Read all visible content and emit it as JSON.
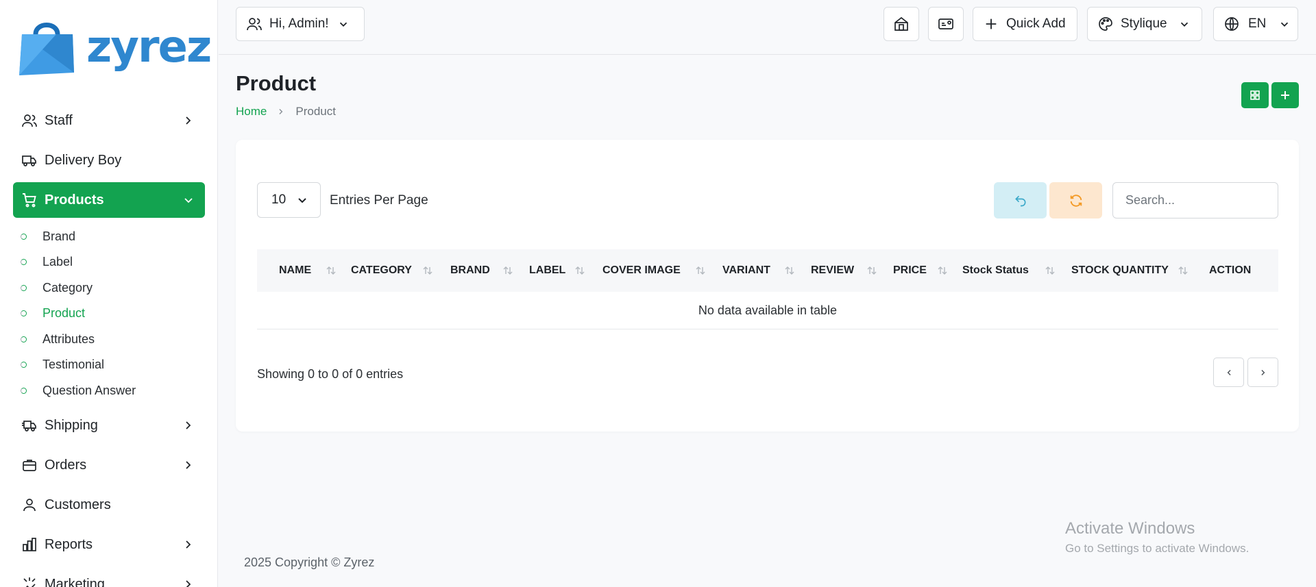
{
  "brand": {
    "name": "zyrez",
    "color": "#2f87cf"
  },
  "sidebar": {
    "items": [
      {
        "label": "Staff",
        "icon": "users-icon",
        "has_children": true
      },
      {
        "label": "Delivery Boy",
        "icon": "truck-icon",
        "has_children": false
      },
      {
        "label": "Products",
        "icon": "cart-icon",
        "has_children": true,
        "expanded": true,
        "active": true
      },
      {
        "label": "Shipping",
        "icon": "shipping-truck-icon",
        "has_children": true
      },
      {
        "label": "Orders",
        "icon": "briefcase-icon",
        "has_children": true
      },
      {
        "label": "Customers",
        "icon": "user-icon",
        "has_children": false
      },
      {
        "label": "Reports",
        "icon": "bar-chart-icon",
        "has_children": true
      },
      {
        "label": "Marketing",
        "icon": "marketing-icon",
        "has_children": true
      }
    ],
    "products_submenu": [
      {
        "label": "Brand"
      },
      {
        "label": "Label"
      },
      {
        "label": "Category"
      },
      {
        "label": "Product",
        "active": true
      },
      {
        "label": "Attributes"
      },
      {
        "label": "Testimonial"
      },
      {
        "label": "Question Answer"
      }
    ]
  },
  "topbar": {
    "greeting": "Hi, Admin!",
    "quick_add": "Quick Add",
    "theme": "Stylique",
    "language": "EN"
  },
  "page": {
    "title": "Product",
    "breadcrumb": {
      "home": "Home",
      "current": "Product"
    }
  },
  "table": {
    "entries_per_page_value": "10",
    "entries_per_page_label": "Entries Per Page",
    "search_placeholder": "Search...",
    "columns": [
      "NAME",
      "CATEGORY",
      "BRAND",
      "LABEL",
      "COVER IMAGE",
      "VARIANT",
      "REVIEW",
      "PRICE",
      "Stock Status",
      "STOCK QUANTITY",
      "ACTION"
    ],
    "empty_message": "No data available in table",
    "showing_text": "Showing 0 to 0 of 0 entries"
  },
  "footer": {
    "copyright": "2025 Copyright © Zyrez"
  },
  "watermark": {
    "title": "Activate Windows",
    "subtitle": "Go to Settings to activate Windows."
  },
  "colors": {
    "accent": "#13a350",
    "info_bg": "#d3eef5",
    "warning_bg": "#fde7cf"
  }
}
